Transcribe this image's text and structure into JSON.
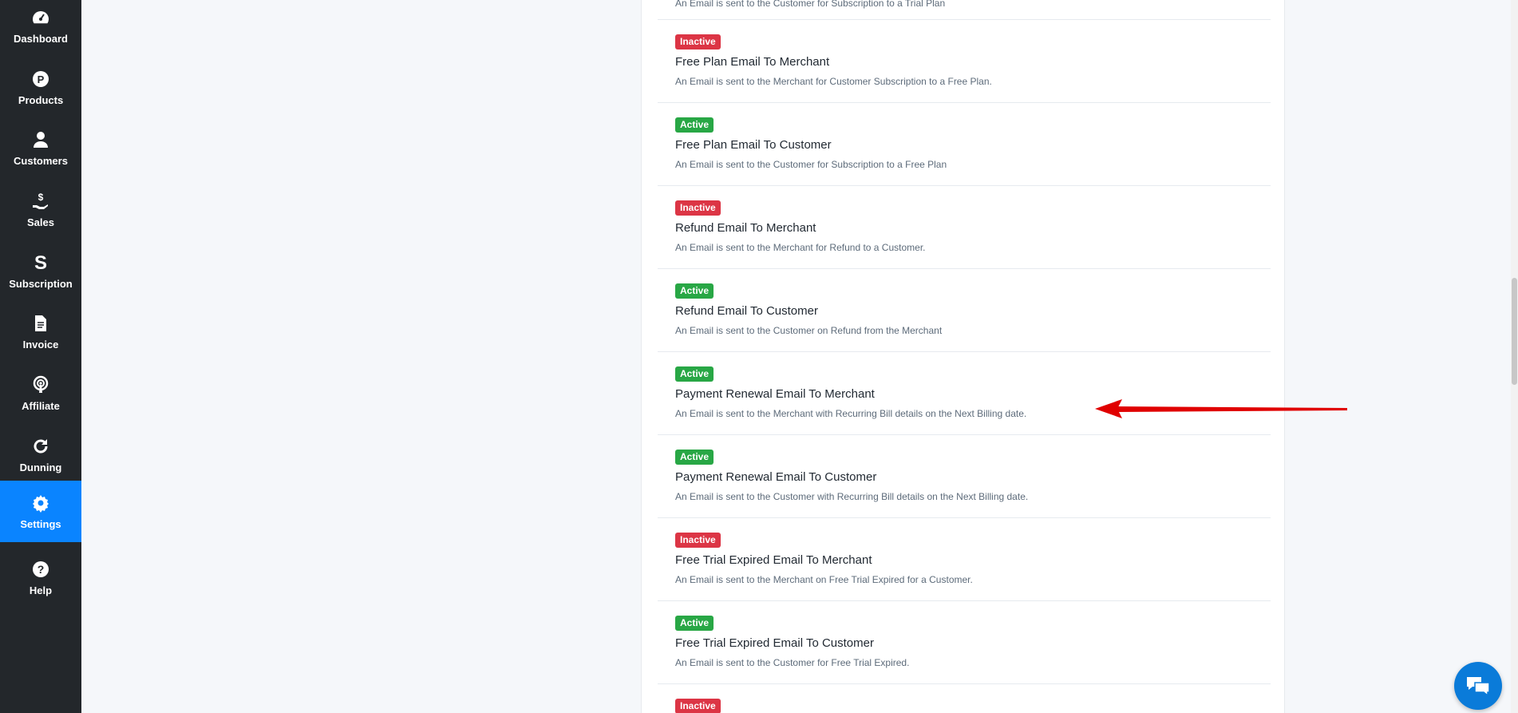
{
  "sidebar": {
    "items": [
      {
        "label": "Dashboard",
        "icon": "gauge-icon"
      },
      {
        "label": "Products",
        "icon": "products-p-icon"
      },
      {
        "label": "Customers",
        "icon": "user-icon"
      },
      {
        "label": "Sales",
        "icon": "hand-dollar-icon"
      },
      {
        "label": "Subscription",
        "icon": "subscription-s-icon"
      },
      {
        "label": "Invoice",
        "icon": "document-icon"
      },
      {
        "label": "Affiliate",
        "icon": "broadcast-icon"
      },
      {
        "label": "Dunning",
        "icon": "redo-icon"
      },
      {
        "label": "Settings",
        "icon": "gear-icon"
      },
      {
        "label": "Help",
        "icon": "question-icon"
      }
    ],
    "active": "Settings"
  },
  "emails": {
    "partial_top_desc": "An Email is sent to the Customer for Subscription to a Trial Plan",
    "items": [
      {
        "status": "Inactive",
        "title": "Free Plan Email To Merchant",
        "desc": "An Email is sent to the Merchant for Customer Subscription to a Free Plan."
      },
      {
        "status": "Active",
        "title": "Free Plan Email To Customer",
        "desc": "An Email is sent to the Customer for Subscription to a Free Plan"
      },
      {
        "status": "Inactive",
        "title": "Refund Email To Merchant",
        "desc": "An Email is sent to the Merchant for Refund to a Customer."
      },
      {
        "status": "Active",
        "title": "Refund Email To Customer",
        "desc": "An Email is sent to the Customer on Refund from the Merchant"
      },
      {
        "status": "Active",
        "title": "Payment Renewal Email To Merchant",
        "desc": "An Email is sent to the Merchant with Recurring Bill details on the Next Billing date."
      },
      {
        "status": "Active",
        "title": "Payment Renewal Email To Customer",
        "desc": "An Email is sent to the Customer with Recurring Bill details on the Next Billing date."
      },
      {
        "status": "Inactive",
        "title": "Free Trial Expired Email To Merchant",
        "desc": "An Email is sent to the Merchant on Free Trial Expired for a Customer."
      },
      {
        "status": "Active",
        "title": "Free Trial Expired Email To Customer",
        "desc": "An Email is sent to the Customer for Free Trial Expired."
      }
    ],
    "partial_bottom_status": "Inactive"
  },
  "colors": {
    "sidebar_bg": "#23272b",
    "active_nav": "#0a84ff",
    "badge_active": "#28a745",
    "badge_inactive": "#dc3545",
    "annotation_arrow": "#e00000",
    "chat_button": "#0a7bd9"
  },
  "chat": {
    "icon": "chat-bubbles-icon"
  }
}
